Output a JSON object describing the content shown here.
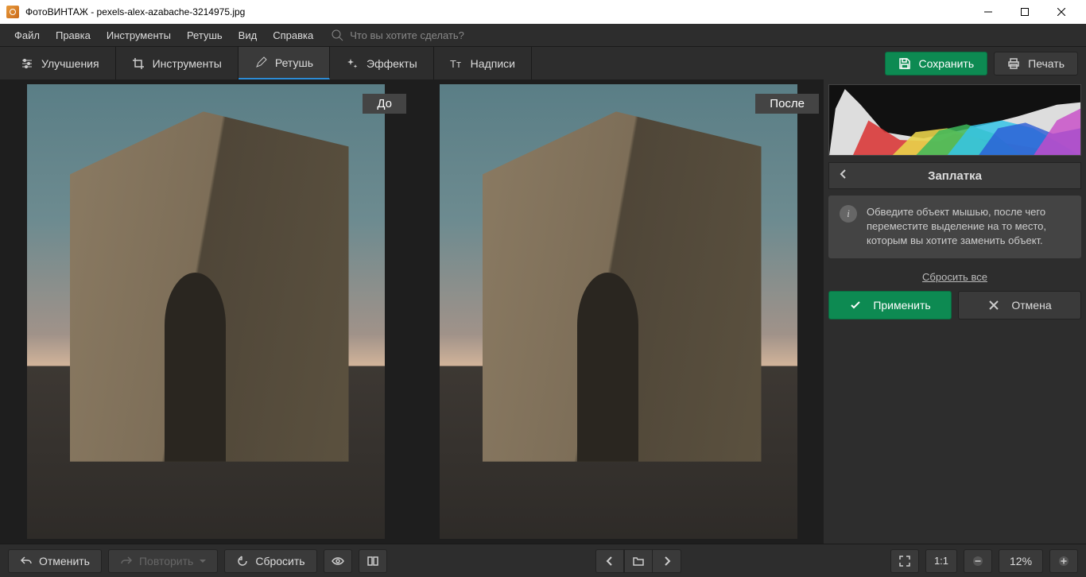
{
  "window": {
    "title": "ФотоВИНТАЖ - pexels-alex-azabache-3214975.jpg"
  },
  "menu": {
    "items": [
      "Файл",
      "Правка",
      "Инструменты",
      "Ретушь",
      "Вид",
      "Справка"
    ],
    "search_placeholder": "Что вы хотите сделать?"
  },
  "tabs": {
    "items": [
      {
        "label": "Улучшения",
        "icon": "sliders-icon"
      },
      {
        "label": "Инструменты",
        "icon": "crop-icon"
      },
      {
        "label": "Ретушь",
        "icon": "brush-icon"
      },
      {
        "label": "Эффекты",
        "icon": "wand-icon"
      },
      {
        "label": "Надписи",
        "icon": "text-icon"
      }
    ],
    "active_index": 2,
    "save": "Сохранить",
    "print": "Печать"
  },
  "canvas": {
    "before_label": "До",
    "after_label": "После"
  },
  "panel": {
    "title": "Заплатка",
    "info": "Обведите объект мышью, после чего переместите выделение на то место, которым вы хотите заменить объект.",
    "reset": "Сбросить все",
    "apply": "Применить",
    "cancel": "Отмена"
  },
  "bottom": {
    "undo": "Отменить",
    "redo": "Повторить",
    "reset": "Сбросить",
    "ratio": "1:1",
    "zoom": "12%"
  },
  "colors": {
    "accent_green": "#0d8a52",
    "accent_blue": "#2d8cd6",
    "bg_dark": "#2d2d2d"
  }
}
